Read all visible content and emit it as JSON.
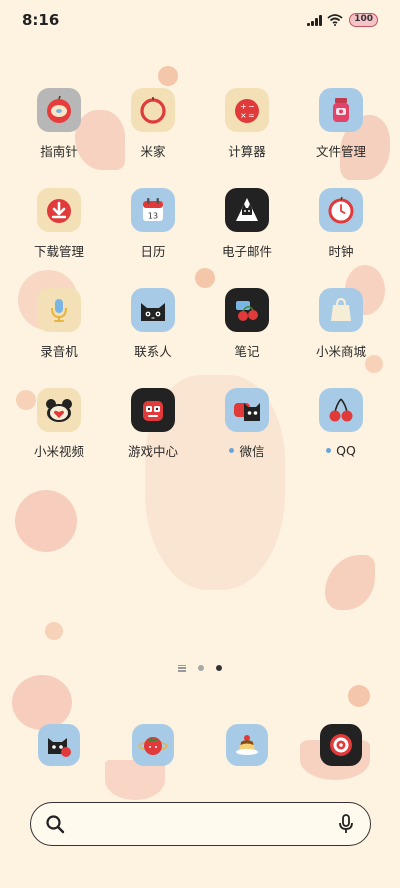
{
  "status_bar": {
    "time": "8:16",
    "battery": "100"
  },
  "apps": [
    {
      "label": "指南针",
      "icon": "compass-apple-icon",
      "bg": "#b7b7b7"
    },
    {
      "label": "米家",
      "icon": "mijia-apple-icon",
      "bg": "#f3e0b6"
    },
    {
      "label": "计算器",
      "icon": "calculator-icon",
      "bg": "#f3e0b6"
    },
    {
      "label": "文件管理",
      "icon": "jam-jar-icon",
      "bg": "#a7cbe6"
    },
    {
      "label": "下载管理",
      "icon": "download-icon",
      "bg": "#f3e0b6"
    },
    {
      "label": "日历",
      "icon": "calendar-icon",
      "bg": "#a7cbe6",
      "day": "13"
    },
    {
      "label": "电子邮件",
      "icon": "email-cat-icon",
      "bg": "#222222"
    },
    {
      "label": "时钟",
      "icon": "clock-apple-icon",
      "bg": "#a7cbe6"
    },
    {
      "label": "录音机",
      "icon": "microphone-icon",
      "bg": "#f3e0b6"
    },
    {
      "label": "联系人",
      "icon": "cat-face-icon",
      "bg": "#a7cbe6"
    },
    {
      "label": "笔记",
      "icon": "cherry-note-icon",
      "bg": "#222222"
    },
    {
      "label": "小米商城",
      "icon": "shopping-bag-icon",
      "bg": "#a7cbe6"
    },
    {
      "label": "小米视频",
      "icon": "video-heart-icon",
      "bg": "#f3e0b6"
    },
    {
      "label": "游戏中心",
      "icon": "gamepad-icon",
      "bg": "#222222"
    },
    {
      "label": "微信",
      "icon": "wechat-cat-icon",
      "bg": "#a7cbe6",
      "dot": true
    },
    {
      "label": "QQ",
      "icon": "cherries-icon",
      "bg": "#a7cbe6",
      "dot": true
    }
  ],
  "dock": [
    {
      "icon": "phone-cat-icon",
      "bg": "#a7cbe6"
    },
    {
      "icon": "messages-tomato-icon",
      "bg": "#a7cbe6"
    },
    {
      "icon": "pudding-icon",
      "bg": "#a7cbe6"
    },
    {
      "icon": "camera-target-icon",
      "bg": "#222222"
    }
  ],
  "page_indicator": {
    "pages": 2,
    "active": 2
  },
  "search": {
    "placeholder": ""
  }
}
